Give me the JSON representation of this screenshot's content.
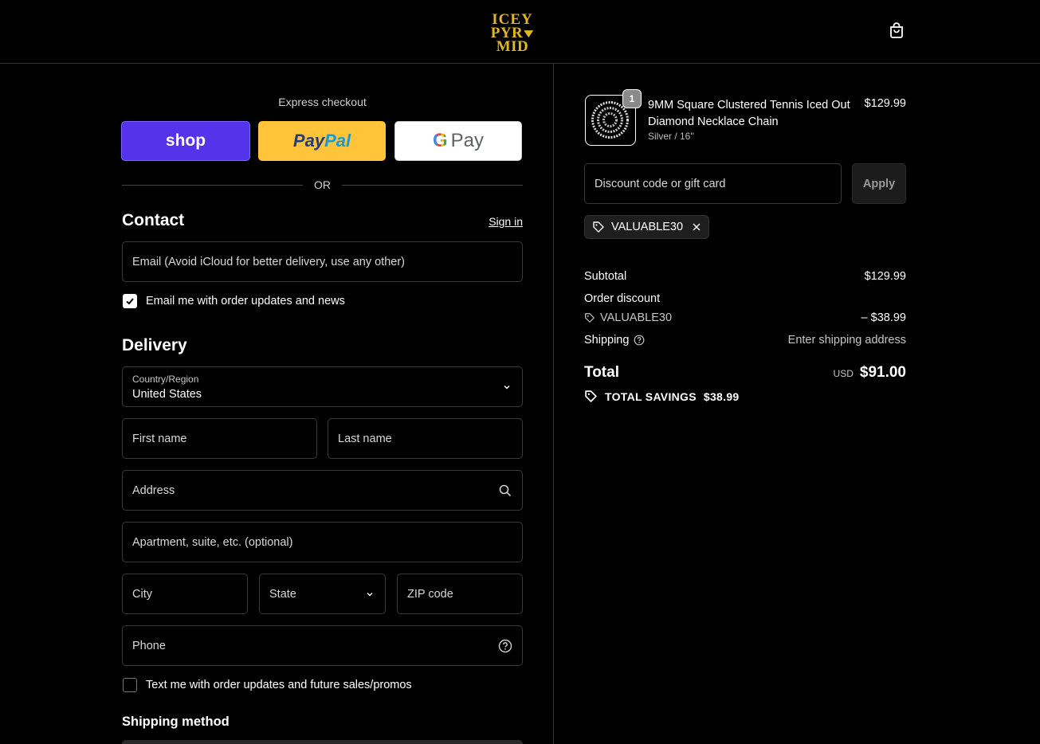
{
  "header": {
    "logo_line1": "ICEY",
    "logo_line2a": "PYR",
    "logo_line2b": "MID",
    "cart_icon": "shopping-bag-icon"
  },
  "express": {
    "title": "Express checkout",
    "shop_label": "shop",
    "paypal_part1": "Pay",
    "paypal_part2": "Pal",
    "gpay_g": "G",
    "gpay_label": "Pay",
    "or": "OR"
  },
  "contact": {
    "title": "Contact",
    "signin": "Sign in",
    "email_placeholder": "Email (Avoid iCloud for better delivery, use any other)",
    "email_optin": "Email me with order updates and news",
    "email_optin_checked": true
  },
  "delivery": {
    "title": "Delivery",
    "country_label": "Country/Region",
    "country_value": "United States",
    "first_name": "First name",
    "last_name": "Last name",
    "address": "Address",
    "apartment": "Apartment, suite, etc. (optional)",
    "city": "City",
    "state": "State",
    "zip": "ZIP code",
    "phone": "Phone",
    "sms_optin": "Text me with order updates and future sales/promos",
    "sms_optin_checked": false
  },
  "shipping_method": {
    "title": "Shipping method"
  },
  "order": {
    "product": {
      "name": "9MM Square Clustered Tennis Iced Out Diamond Necklace Chain",
      "variant": "Silver / 16''",
      "price": "$129.99",
      "quantity": "1"
    },
    "discount_placeholder": "Discount code or gift card",
    "apply_label": "Apply",
    "applied_code": "VALUABLE30",
    "subtotal_label": "Subtotal",
    "subtotal_value": "$129.99",
    "order_discount_label": "Order discount",
    "discount_code": "VALUABLE30",
    "discount_value": "– $38.99",
    "shipping_label": "Shipping",
    "shipping_value": "Enter shipping address",
    "total_label": "Total",
    "total_currency": "USD",
    "total_value": "$91.00",
    "savings_label": "TOTAL SAVINGS",
    "savings_value": "$38.99"
  }
}
